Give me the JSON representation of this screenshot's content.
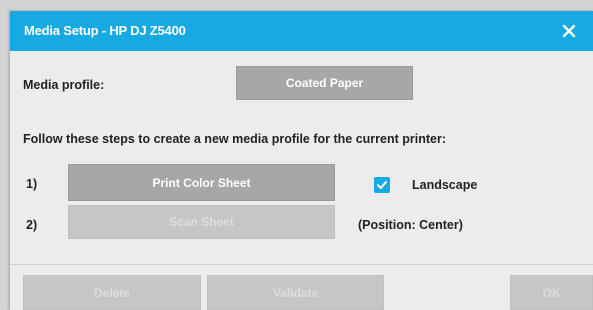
{
  "window": {
    "title": "Media Setup - HP DJ Z5400",
    "close_icon": "close-icon"
  },
  "media_profile": {
    "label": "Media profile:",
    "value": "Coated Paper"
  },
  "instructions": "Follow these steps to create a new media profile for the current printer:",
  "steps": [
    {
      "number": "1)",
      "button_label": "Print Color Sheet",
      "enabled": true
    },
    {
      "number": "2)",
      "button_label": "Scan Sheet",
      "enabled": false
    }
  ],
  "landscape": {
    "label": "Landscape",
    "checked": true
  },
  "position_note": "(Position: Center)",
  "footer": {
    "delete_label": "Delete",
    "validate_label": "Validate",
    "ok_label": "OK"
  },
  "colors": {
    "accent": "#16a9e2",
    "button": "#a7a7a7",
    "button_disabled": "#c6c6c6"
  }
}
